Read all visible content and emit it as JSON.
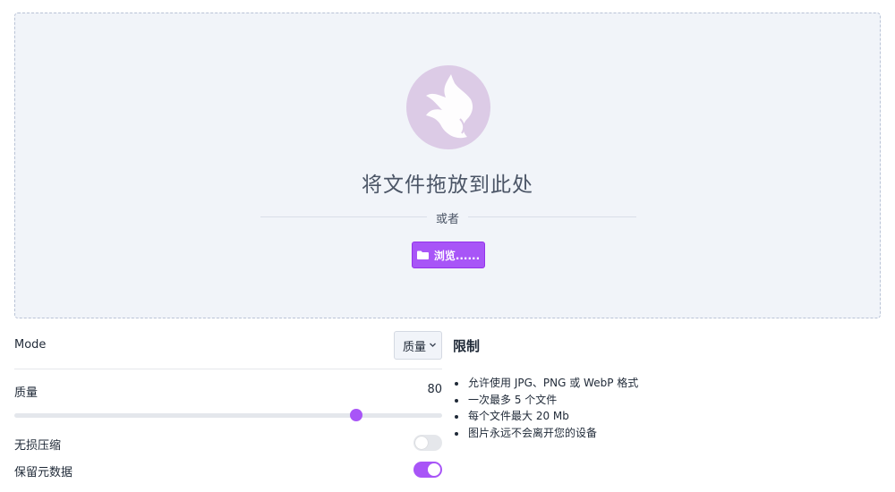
{
  "dropzone": {
    "title": "将文件拖放到此处",
    "or": "或者",
    "browse_label": "浏览......",
    "browse_icon": "folder-icon"
  },
  "settings": {
    "mode_label": "Mode",
    "mode_value": "质量",
    "quality_label": "质量",
    "quality_value": "80",
    "quality_fraction": 0.8,
    "lossless_label": "无损压缩",
    "lossless_on": false,
    "metadata_label": "保留元数据",
    "metadata_on": true
  },
  "limits": {
    "title": "限制",
    "items": [
      "允许使用 JPG、PNG 或 WebP 格式",
      "一次最多 5 个文件",
      "每个文件最大 20 Mb",
      "图片永远不会离开您的设备"
    ]
  },
  "colors": {
    "accent": "#a855f7",
    "dropzone_bg": "#f1f4f9",
    "logo_bg": "#dccbe6"
  }
}
